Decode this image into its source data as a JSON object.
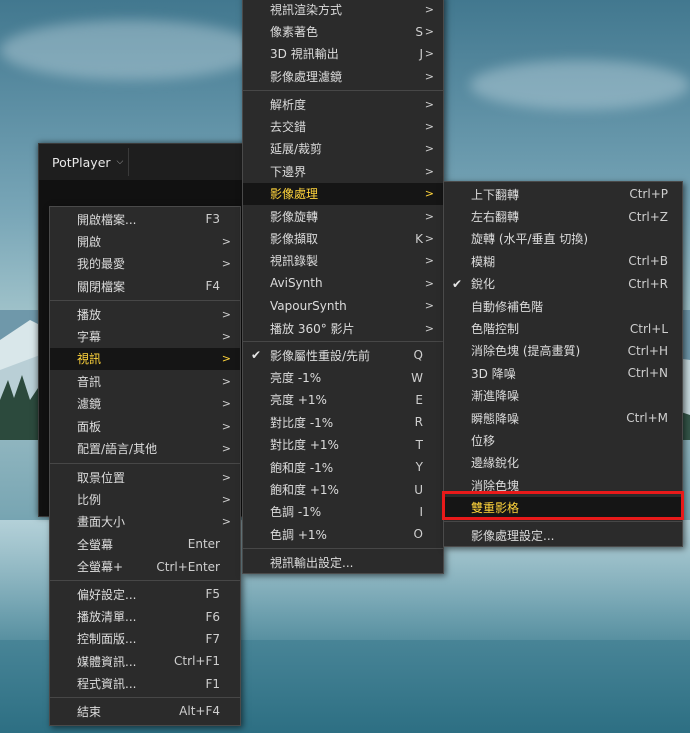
{
  "player": {
    "title": "PotPlayer",
    "title_chevron": "⌵"
  },
  "menu_main": {
    "items": [
      {
        "label": "開啟檔案...",
        "shortcut": "F3",
        "arrow": ""
      },
      {
        "label": "開啟",
        "shortcut": "",
        "arrow": ">"
      },
      {
        "label": "我的最愛",
        "shortcut": "",
        "arrow": ">"
      },
      {
        "label": "關閉檔案",
        "shortcut": "F4",
        "arrow": ""
      },
      {
        "label": "播放",
        "shortcut": "",
        "arrow": ">"
      },
      {
        "label": "字幕",
        "shortcut": "",
        "arrow": ">"
      },
      {
        "label": "視訊",
        "shortcut": "",
        "arrow": ">"
      },
      {
        "label": "音訊",
        "shortcut": "",
        "arrow": ">"
      },
      {
        "label": "濾鏡",
        "shortcut": "",
        "arrow": ">"
      },
      {
        "label": "面板",
        "shortcut": "",
        "arrow": ">"
      },
      {
        "label": "配置/語言/其他",
        "shortcut": "",
        "arrow": ">"
      },
      {
        "label": "取景位置",
        "shortcut": "",
        "arrow": ">"
      },
      {
        "label": "比例",
        "shortcut": "",
        "arrow": ">"
      },
      {
        "label": "畫面大小",
        "shortcut": "",
        "arrow": ">"
      },
      {
        "label": "全螢幕",
        "shortcut": "Enter",
        "arrow": ""
      },
      {
        "label": "全螢幕+",
        "shortcut": "Ctrl+Enter",
        "arrow": ""
      },
      {
        "label": "偏好設定...",
        "shortcut": "F5",
        "arrow": ""
      },
      {
        "label": "播放清單...",
        "shortcut": "F6",
        "arrow": ""
      },
      {
        "label": "控制面版...",
        "shortcut": "F7",
        "arrow": ""
      },
      {
        "label": "媒體資訊...",
        "shortcut": "Ctrl+F1",
        "arrow": ""
      },
      {
        "label": "程式資訊...",
        "shortcut": "F1",
        "arrow": ""
      },
      {
        "label": "結束",
        "shortcut": "Alt+F4",
        "arrow": ""
      }
    ]
  },
  "menu_video": {
    "items": [
      {
        "label": "視訊渲染方式",
        "shortcut": "",
        "arrow": ">"
      },
      {
        "label": "像素著色",
        "shortcut": "S",
        "arrow": ">"
      },
      {
        "label": "3D 視訊輸出",
        "shortcut": "J",
        "arrow": ">"
      },
      {
        "label": "影像處理濾鏡",
        "shortcut": "",
        "arrow": ">"
      },
      {
        "label": "解析度",
        "shortcut": "",
        "arrow": ">"
      },
      {
        "label": "去交錯",
        "shortcut": "",
        "arrow": ">"
      },
      {
        "label": "延展/裁剪",
        "shortcut": "",
        "arrow": ">"
      },
      {
        "label": "下邊界",
        "shortcut": "",
        "arrow": ">"
      },
      {
        "label": "影像處理",
        "shortcut": "",
        "arrow": ">"
      },
      {
        "label": "影像旋轉",
        "shortcut": "",
        "arrow": ">"
      },
      {
        "label": "影像擷取",
        "shortcut": "K",
        "arrow": ">"
      },
      {
        "label": "視訊錄製",
        "shortcut": "",
        "arrow": ">"
      },
      {
        "label": "AviSynth",
        "shortcut": "",
        "arrow": ">"
      },
      {
        "label": "VapourSynth",
        "shortcut": "",
        "arrow": ">"
      },
      {
        "label": "播放 360° 影片",
        "shortcut": "",
        "arrow": ">"
      },
      {
        "label": "影像屬性重設/先前",
        "shortcut": "Q",
        "arrow": "",
        "checked": "✔"
      },
      {
        "label": "亮度 -1%",
        "shortcut": "W",
        "arrow": ""
      },
      {
        "label": "亮度 +1%",
        "shortcut": "E",
        "arrow": ""
      },
      {
        "label": "對比度 -1%",
        "shortcut": "R",
        "arrow": ""
      },
      {
        "label": "對比度 +1%",
        "shortcut": "T",
        "arrow": ""
      },
      {
        "label": "飽和度 -1%",
        "shortcut": "Y",
        "arrow": ""
      },
      {
        "label": "飽和度 +1%",
        "shortcut": "U",
        "arrow": ""
      },
      {
        "label": "色調 -1%",
        "shortcut": "I",
        "arrow": ""
      },
      {
        "label": "色調 +1%",
        "shortcut": "O",
        "arrow": ""
      },
      {
        "label": "視訊輸出設定...",
        "shortcut": "",
        "arrow": ""
      }
    ]
  },
  "menu_image": {
    "items": [
      {
        "label": "上下翻轉",
        "shortcut": "Ctrl+P"
      },
      {
        "label": "左右翻轉",
        "shortcut": "Ctrl+Z"
      },
      {
        "label": "旋轉 (水平/垂直 切換)",
        "shortcut": ""
      },
      {
        "label": "模糊",
        "shortcut": "Ctrl+B"
      },
      {
        "label": "銳化",
        "shortcut": "Ctrl+R",
        "checked": "✔"
      },
      {
        "label": "自動修補色階",
        "shortcut": ""
      },
      {
        "label": "色階控制",
        "shortcut": "Ctrl+L"
      },
      {
        "label": "消除色塊 (提高畫質)",
        "shortcut": "Ctrl+H"
      },
      {
        "label": "3D 降噪",
        "shortcut": "Ctrl+N"
      },
      {
        "label": "漸進降噪",
        "shortcut": ""
      },
      {
        "label": "瞬態降噪",
        "shortcut": "Ctrl+M"
      },
      {
        "label": "位移",
        "shortcut": ""
      },
      {
        "label": "邊緣銳化",
        "shortcut": ""
      },
      {
        "label": "消除色塊",
        "shortcut": ""
      },
      {
        "label": "雙重影格",
        "shortcut": ""
      },
      {
        "label": "影像處理設定...",
        "shortcut": ""
      }
    ]
  },
  "colors": {
    "highlight_text": "#ffd43b",
    "menu_bg": "#2b2b2b",
    "annotation_box": "#e81a1a"
  }
}
